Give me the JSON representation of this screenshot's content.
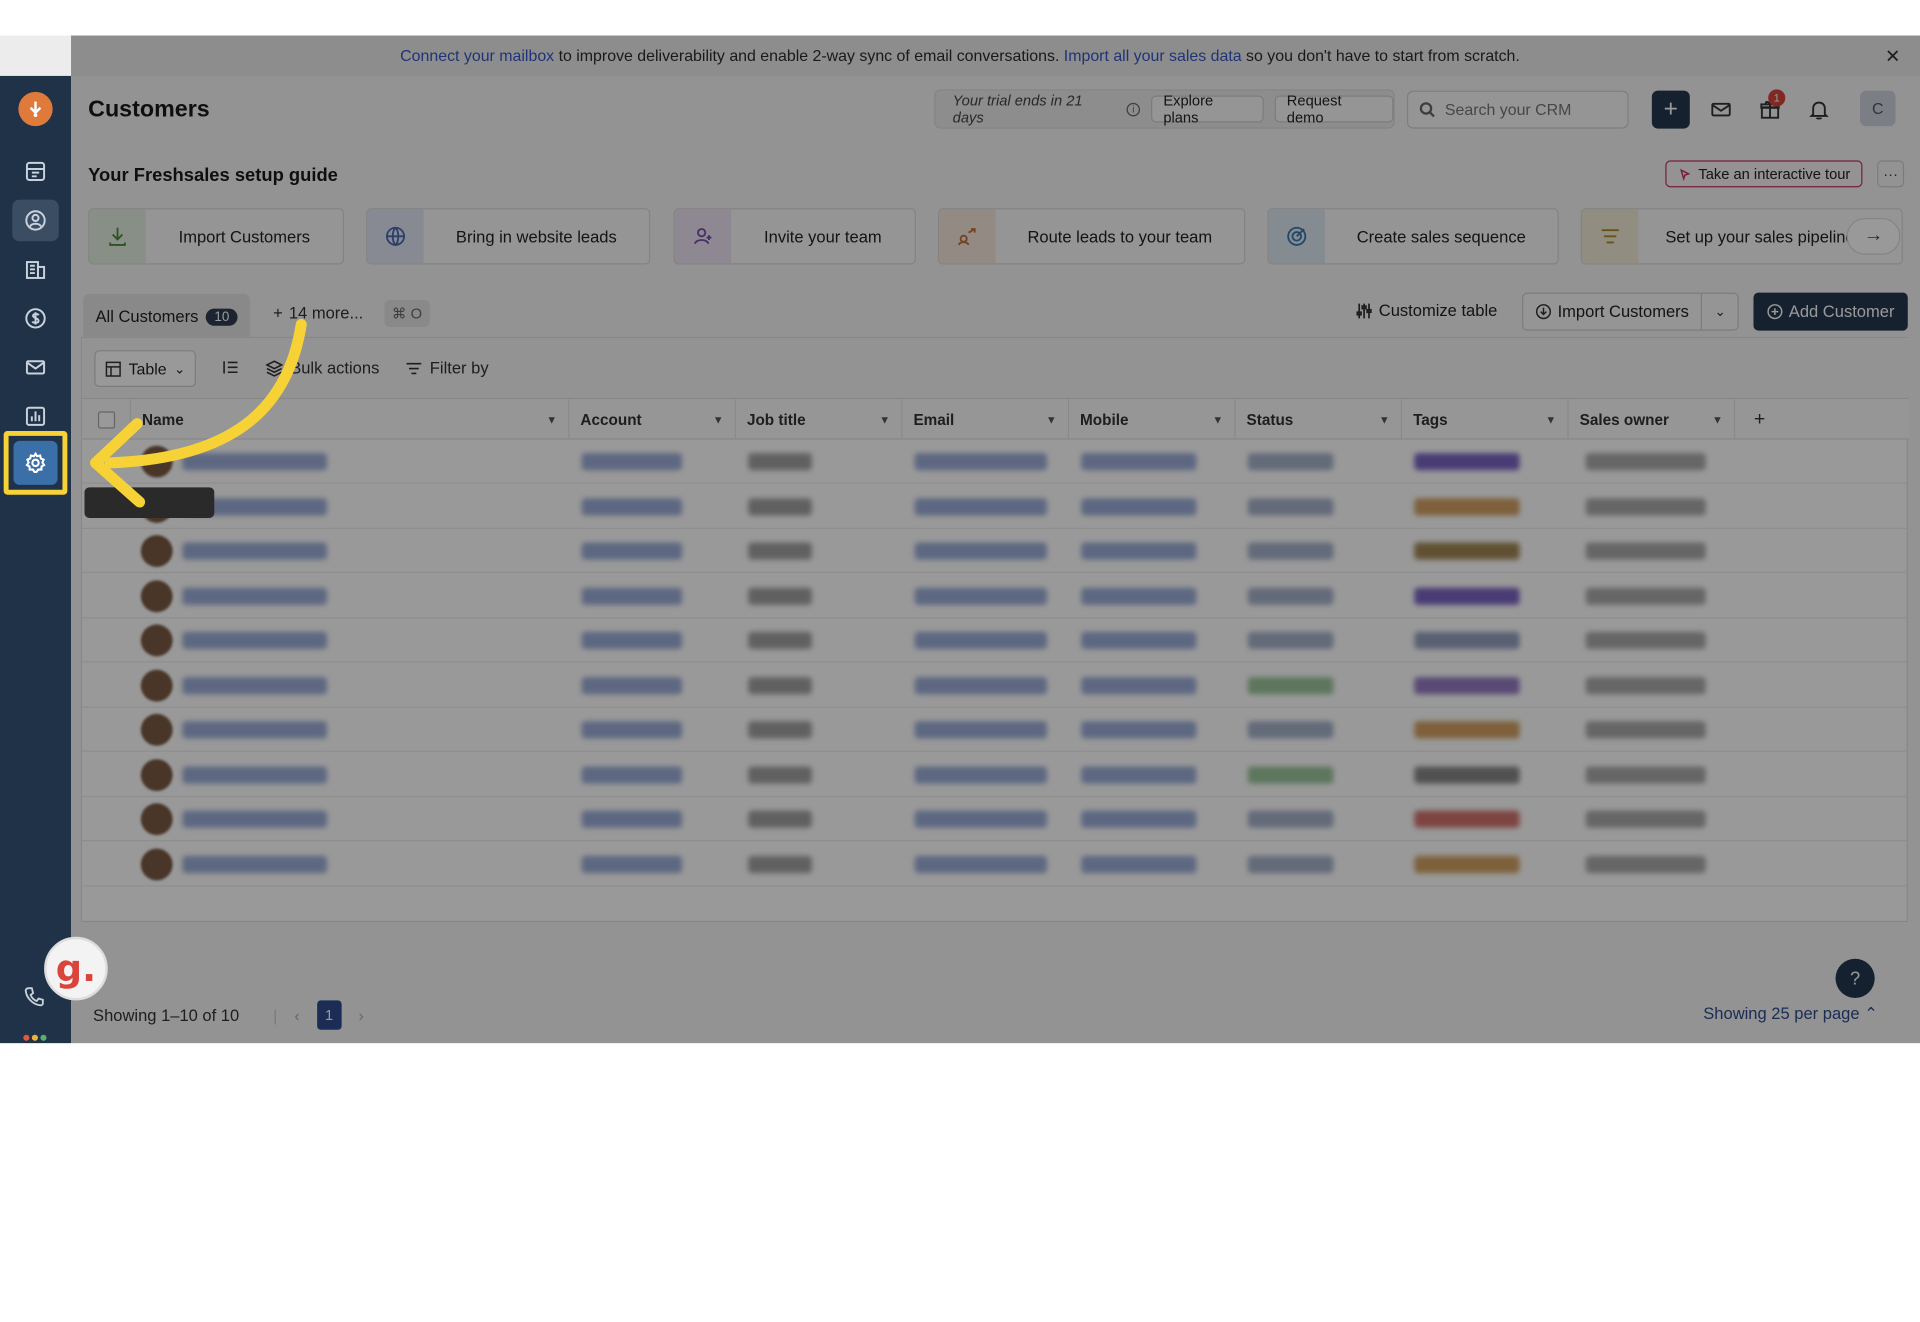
{
  "banner": {
    "link1": "Connect your mailbox",
    "text1": " to improve deliverability and enable 2-way sync of email conversations. ",
    "link2": "Import all your sales data",
    "text2": " so you don't have to start from scratch.",
    "close": "✕"
  },
  "header": {
    "title": "Customers",
    "trial_text": "Your trial ends in 21 days",
    "explore_plans": "Explore plans",
    "request_demo": "Request demo",
    "search_placeholder": "Search your CRM",
    "plus": "+",
    "gift_badge": "1",
    "avatar_initial": "C"
  },
  "guide": {
    "title": "Your Freshsales setup guide",
    "tour_button": "Take an interactive tour",
    "more": "···",
    "cards": [
      {
        "label": "Import Customers",
        "icon": "download-icon",
        "color": "#4b8b3b"
      },
      {
        "label": "Bring in website leads",
        "icon": "globe-icon",
        "color": "#4a68b0"
      },
      {
        "label": "Invite your team",
        "icon": "user-add-icon",
        "color": "#7a4fb0"
      },
      {
        "label": "Route leads to your team",
        "icon": "route-icon",
        "color": "#c0703a"
      },
      {
        "label": "Create sales sequence",
        "icon": "target-icon",
        "color": "#3a78b0"
      },
      {
        "label": "Set up your sales pipeline",
        "icon": "pipeline-icon",
        "color": "#b0882e"
      }
    ],
    "next": "→"
  },
  "views": {
    "all_label": "All Customers",
    "all_count": "10",
    "more_label": "14 more...",
    "shortcut": "⌘ O"
  },
  "actions": {
    "customize": "Customize table",
    "import": "Import Customers",
    "add": "Add Customer"
  },
  "toolbar": {
    "view": "Table",
    "bulk": "Bulk actions",
    "filter": "Filter by"
  },
  "columns": [
    "Name",
    "Account",
    "Job title",
    "Email",
    "Mobile",
    "Status",
    "Tags",
    "Sales owner"
  ],
  "rows": [
    {
      "tag_color": "#5a3fb5",
      "status_color": "#6b7fa8"
    },
    {
      "tag_color": "#c7893b",
      "status_color": "#6b7fa8"
    },
    {
      "tag_color": "#8a6a2a",
      "status_color": "#6b7fa8"
    },
    {
      "tag_color": "#5a3fb5",
      "status_color": "#6b7fa8"
    },
    {
      "tag_color": "#7a8ab0",
      "status_color": "#6b7fa8"
    },
    {
      "tag_color": "#7a5ab5",
      "status_color": "#5aa05a"
    },
    {
      "tag_color": "#c7893b",
      "status_color": "#6b7fa8"
    },
    {
      "tag_color": "#6a6a6a",
      "status_color": "#5aa05a"
    },
    {
      "tag_color": "#c7504a",
      "status_color": "#6b7fa8"
    },
    {
      "tag_color": "#c7893b",
      "status_color": "#6b7fa8"
    }
  ],
  "footer": {
    "showing": "Showing 1–10 of 10",
    "page": "1",
    "per_page": "Showing 25 per page"
  },
  "help": "?",
  "brand_badge": "g.",
  "colors": {
    "sidebar": "#1f3247",
    "primary": "#23384f",
    "highlight": "#f6d237",
    "link": "#3557c8"
  }
}
